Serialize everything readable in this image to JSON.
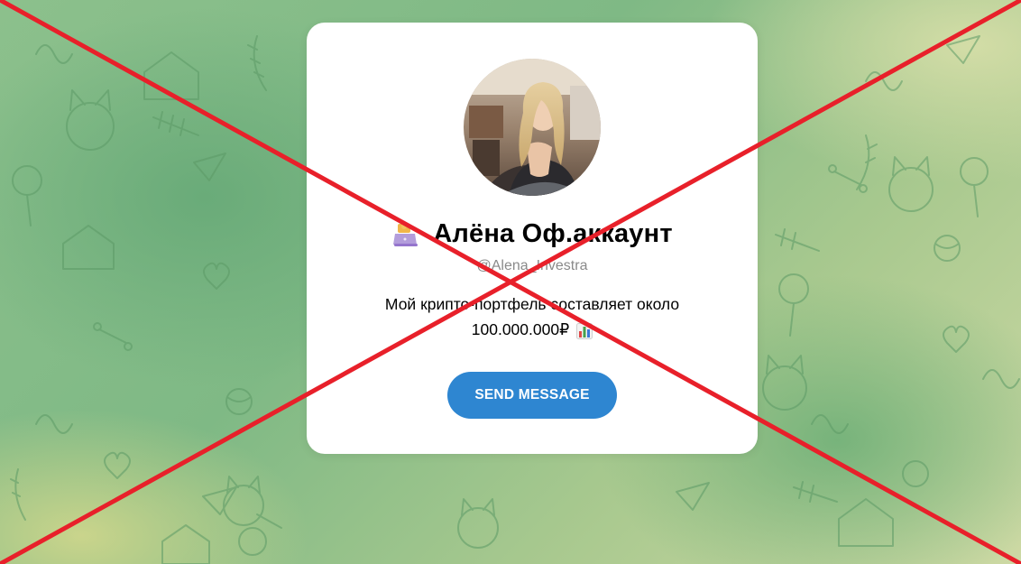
{
  "profile": {
    "name": "Алёна Оф.аккаунт",
    "username": "@Alena_Investra",
    "bio_line1": "Мой крипто-портфель составляет около",
    "bio_line2": "100.000.000₽",
    "name_emoji": "laptop-with-cat-emoji",
    "bio_emoji": "bar-chart-emoji"
  },
  "actions": {
    "send_message_label": "SEND MESSAGE"
  },
  "overlay": {
    "type": "red-cross-mark",
    "color": "#e8202a"
  },
  "colors": {
    "accent": "#2e86d1",
    "background": "#8cc08c"
  }
}
